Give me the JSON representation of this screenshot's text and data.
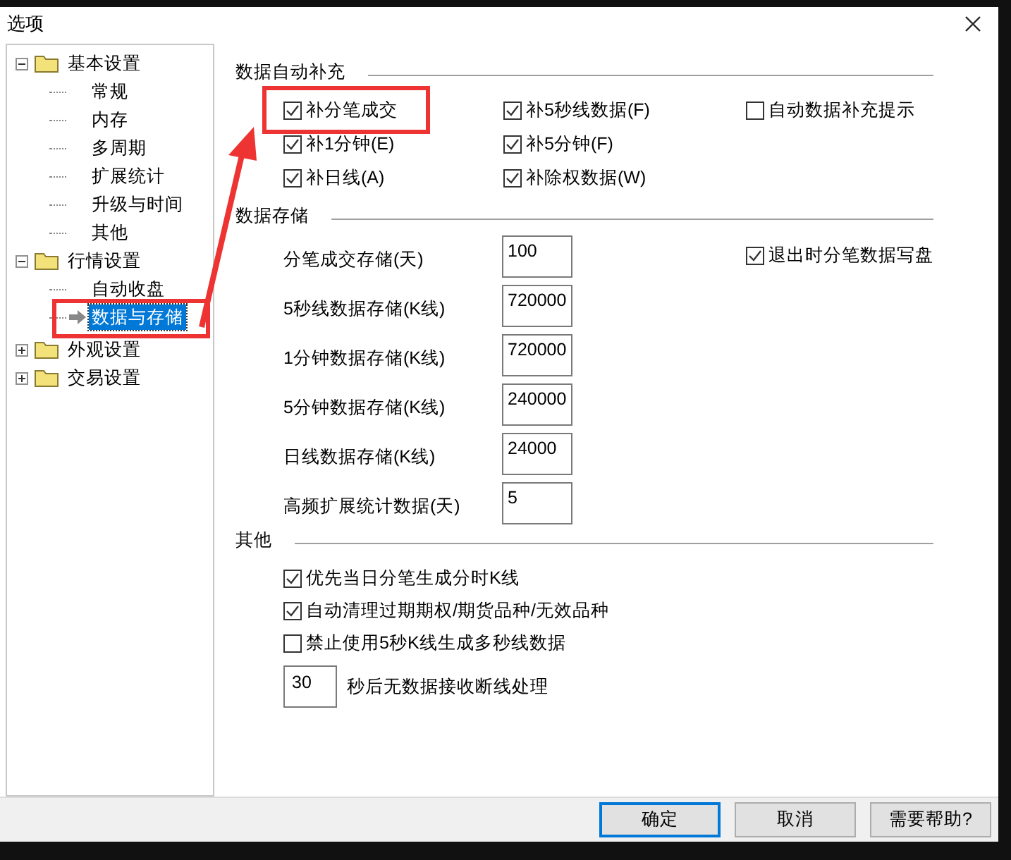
{
  "window": {
    "title": "选项"
  },
  "tree": [
    {
      "label": "基本设置",
      "expanded": true,
      "children": [
        {
          "label": "常规",
          "selected": false
        },
        {
          "label": "内存",
          "selected": false
        },
        {
          "label": "多周期",
          "selected": false
        },
        {
          "label": "扩展统计",
          "selected": false
        },
        {
          "label": "升级与时间",
          "selected": false
        },
        {
          "label": "其他",
          "selected": false
        }
      ]
    },
    {
      "label": "行情设置",
      "expanded": true,
      "children": [
        {
          "label": "自动收盘",
          "selected": false
        },
        {
          "label": "数据与存储",
          "selected": true
        }
      ]
    },
    {
      "label": "外观设置",
      "expanded": false
    },
    {
      "label": "交易设置",
      "expanded": false
    }
  ],
  "auto_fill": {
    "title": "数据自动补充",
    "options": [
      {
        "label": "补分笔成交",
        "checked": true
      },
      {
        "label": "补5秒线数据(F)",
        "checked": true
      },
      {
        "label": "自动数据补充提示",
        "checked": false
      },
      {
        "label": "补1分钟(E)",
        "checked": true
      },
      {
        "label": "补5分钟(F)",
        "checked": true
      },
      {
        "label": "补日线(A)",
        "checked": true
      },
      {
        "label": "补除权数据(W)",
        "checked": true
      }
    ]
  },
  "storage": {
    "title": "数据存储",
    "fields": [
      {
        "label": "分笔成交存储(天)",
        "value": "100"
      },
      {
        "label": "5秒线数据存储(K线)",
        "value": "720000"
      },
      {
        "label": "1分钟数据存储(K线)",
        "value": "720000"
      },
      {
        "label": "5分钟数据存储(K线)",
        "value": "240000"
      },
      {
        "label": "日线数据存储(K线)",
        "value": "24000"
      },
      {
        "label": "高频扩展统计数据(天)",
        "value": "5"
      }
    ],
    "exit_option": {
      "label": "退出时分笔数据写盘",
      "checked": true
    }
  },
  "other": {
    "title": "其他",
    "options": [
      {
        "label": "优先当日分笔生成分时K线",
        "checked": true
      },
      {
        "label": "自动清理过期期权/期货品种/无效品种",
        "checked": true
      },
      {
        "label": "禁止使用5秒K线生成多秒线数据",
        "checked": false
      }
    ],
    "timeout": {
      "value": "30",
      "label": "秒后无数据接收断线处理"
    }
  },
  "buttons": [
    {
      "label": "确定",
      "default": true
    },
    {
      "label": "取消",
      "default": false
    },
    {
      "label": "需要帮助?",
      "default": false
    }
  ]
}
